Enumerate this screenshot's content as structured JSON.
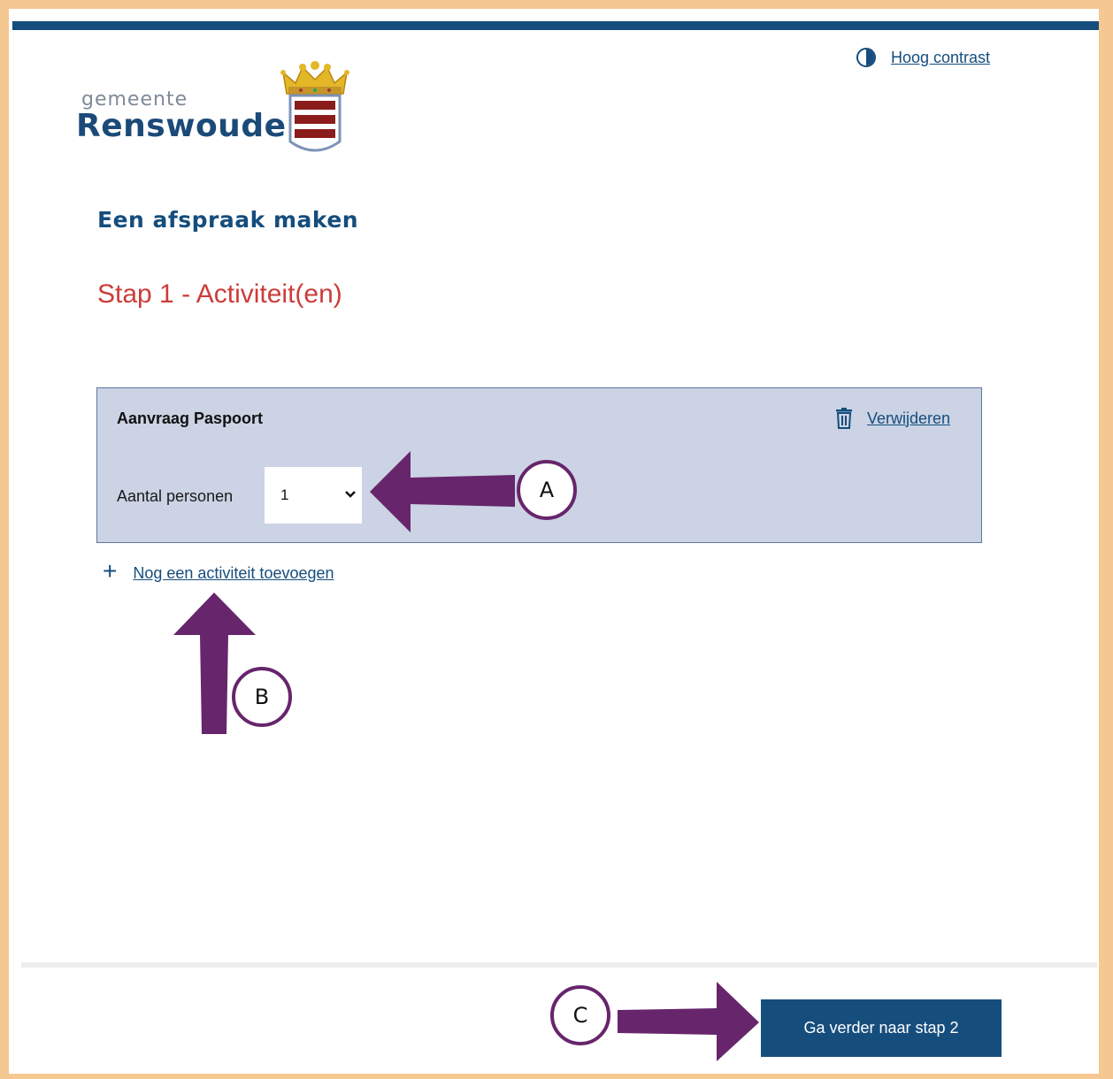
{
  "header": {
    "contrast_label": "Hoog contrast",
    "logo": {
      "prefix": "gemeente",
      "name": "Renswoude"
    }
  },
  "main": {
    "title": "Een afspraak maken",
    "step_title": "Stap 1 - Activiteit(en)",
    "activity": {
      "name": "Aanvraag Paspoort",
      "remove_label": "Verwijderen",
      "persons_label": "Aantal personen",
      "persons_value": "1"
    },
    "add_activity_label": "Nog een activiteit toevoegen"
  },
  "footer": {
    "next_label": "Ga verder naar stap 2"
  },
  "annotations": {
    "a": "A",
    "b": "B",
    "c": "C"
  },
  "colors": {
    "brand_blue": "#154d7d",
    "step_red": "#cc3c39",
    "arrow_purple": "#67256c",
    "card_bg": "#cbd3e4"
  }
}
